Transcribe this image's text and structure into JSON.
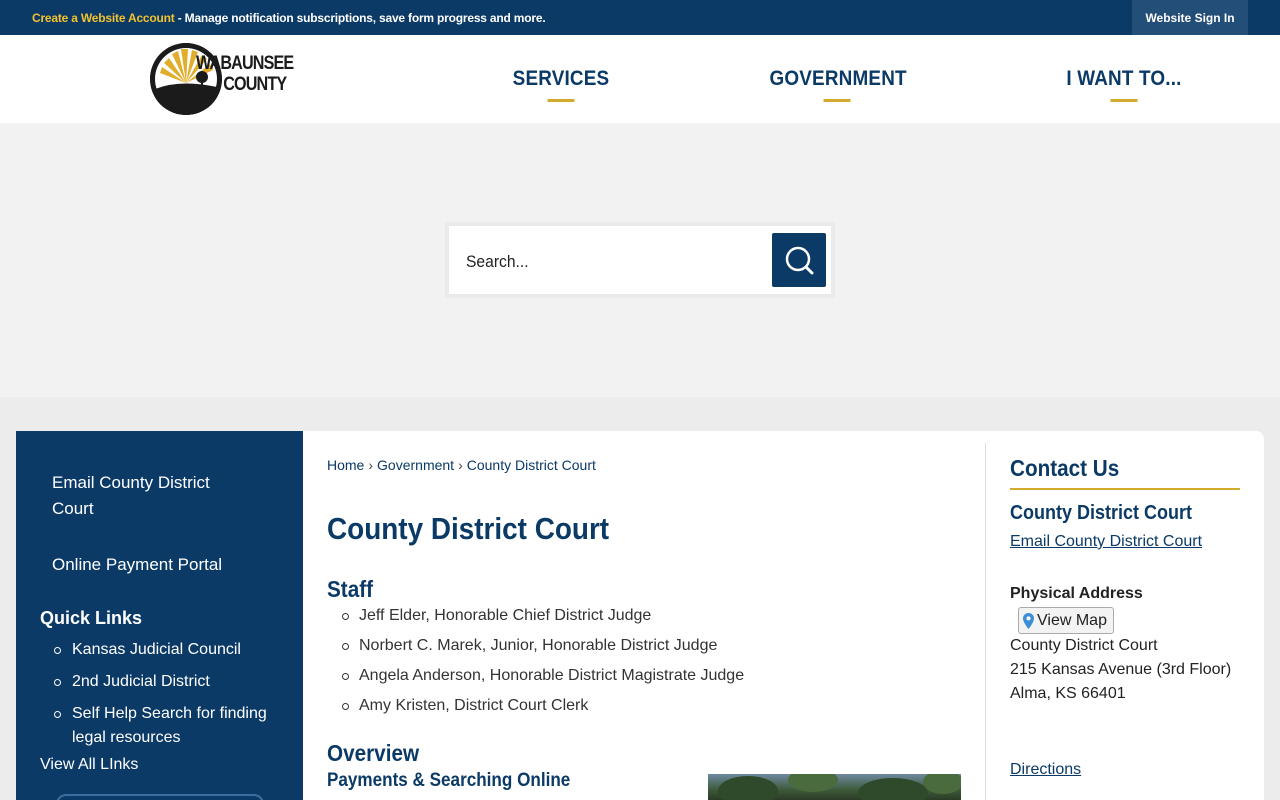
{
  "topbar": {
    "create_account": "Create a Website Account",
    "message": " - Manage notification subscriptions, save form progress and more.",
    "sign_in": "Website Sign In"
  },
  "header": {
    "logo": {
      "line1": "WABAUNSEE",
      "line2": "COUNTY",
      "icon": "sunburst-logo-icon"
    },
    "nav": [
      {
        "label": "SERVICES"
      },
      {
        "label": "GOVERNMENT"
      },
      {
        "label": "I WANT TO..."
      }
    ]
  },
  "search": {
    "placeholder": "Search...",
    "icon": "search-icon"
  },
  "sidebar": {
    "links": [
      "Email County District Court",
      "Online Payment Portal"
    ],
    "quick_links_title": "Quick Links",
    "quick_links": [
      "Kansas Judicial Council",
      "2nd Judicial District",
      "Self Help Search for finding legal resources"
    ],
    "view_all": "View All LInks"
  },
  "main": {
    "breadcrumb": [
      "Home",
      "Government",
      "County District Court"
    ],
    "title": "County District Court",
    "staff_heading": "Staff",
    "staff": [
      "Jeff Elder, Honorable Chief District Judge",
      "Norbert C. Marek, Junior, Honorable District Judge",
      "Angela Anderson, Honorable District Magistrate Judge",
      "Amy Kristen, District Court Clerk"
    ],
    "overview_heading": "Overview",
    "payments_heading": "Payments & Searching Online"
  },
  "contact": {
    "title": "Contact Us",
    "org": "County District Court",
    "email_link": "Email County District Court",
    "address_label": "Physical Address",
    "view_map": "View Map",
    "address": [
      "County District Court",
      "215 Kansas Avenue (3rd Floor)",
      "Alma, KS 66401"
    ],
    "directions": "Directions"
  },
  "colors": {
    "navy": "#0b3a66",
    "gold": "#d4aa2c",
    "background": "#f2f2f2"
  }
}
